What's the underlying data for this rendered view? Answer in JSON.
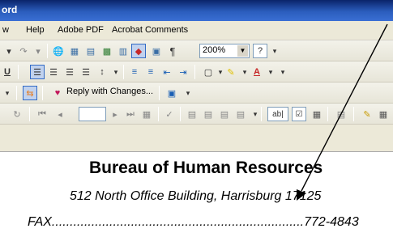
{
  "window": {
    "title_fragment": "ord"
  },
  "menu": [
    {
      "label": "w"
    },
    {
      "label": "Help"
    },
    {
      "label": "Adobe PDF"
    },
    {
      "label": "Acrobat Comments"
    }
  ],
  "toolbar_standard": {
    "zoom": "200%",
    "pilcrow": "¶"
  },
  "toolbar_formatting": {
    "underline": "U"
  },
  "toolbar_review": {
    "reply_label": "Reply with Changes..."
  },
  "document": {
    "title": "Bureau of Human Resources",
    "address": "512 North Office Building, Harrisburg 17125",
    "fax_line": "FAX......................................................................772-4843"
  }
}
